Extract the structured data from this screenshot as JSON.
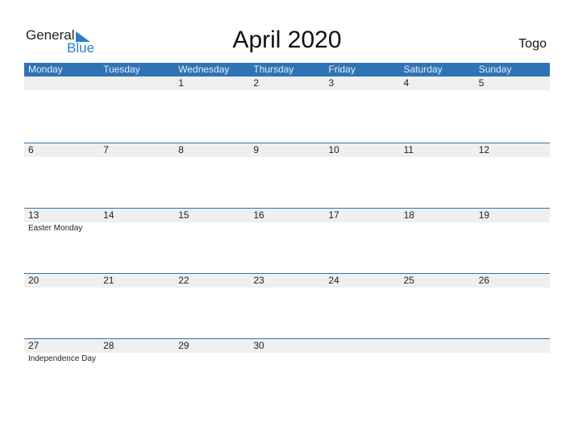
{
  "logo": {
    "general": "General",
    "blue": "Blue"
  },
  "title": "April 2020",
  "country": "Togo",
  "weekdays": [
    "Monday",
    "Tuesday",
    "Wednesday",
    "Thursday",
    "Friday",
    "Saturday",
    "Sunday"
  ],
  "weeks": [
    {
      "days": [
        "",
        "",
        "1",
        "2",
        "3",
        "4",
        "5"
      ],
      "notes": [
        "",
        "",
        "",
        "",
        "",
        "",
        ""
      ]
    },
    {
      "days": [
        "6",
        "7",
        "8",
        "9",
        "10",
        "11",
        "12"
      ],
      "notes": [
        "",
        "",
        "",
        "",
        "",
        "",
        ""
      ]
    },
    {
      "days": [
        "13",
        "14",
        "15",
        "16",
        "17",
        "18",
        "19"
      ],
      "notes": [
        "Easter Monday",
        "",
        "",
        "",
        "",
        "",
        ""
      ]
    },
    {
      "days": [
        "20",
        "21",
        "22",
        "23",
        "24",
        "25",
        "26"
      ],
      "notes": [
        "",
        "",
        "",
        "",
        "",
        "",
        ""
      ]
    },
    {
      "days": [
        "27",
        "28",
        "29",
        "30",
        "",
        "",
        ""
      ],
      "notes": [
        "Independence Day",
        "",
        "",
        "",
        "",
        "",
        ""
      ]
    }
  ],
  "colors": {
    "header": "#2e73b5",
    "strip": "#efefef",
    "brand": "#2a7fc8"
  }
}
